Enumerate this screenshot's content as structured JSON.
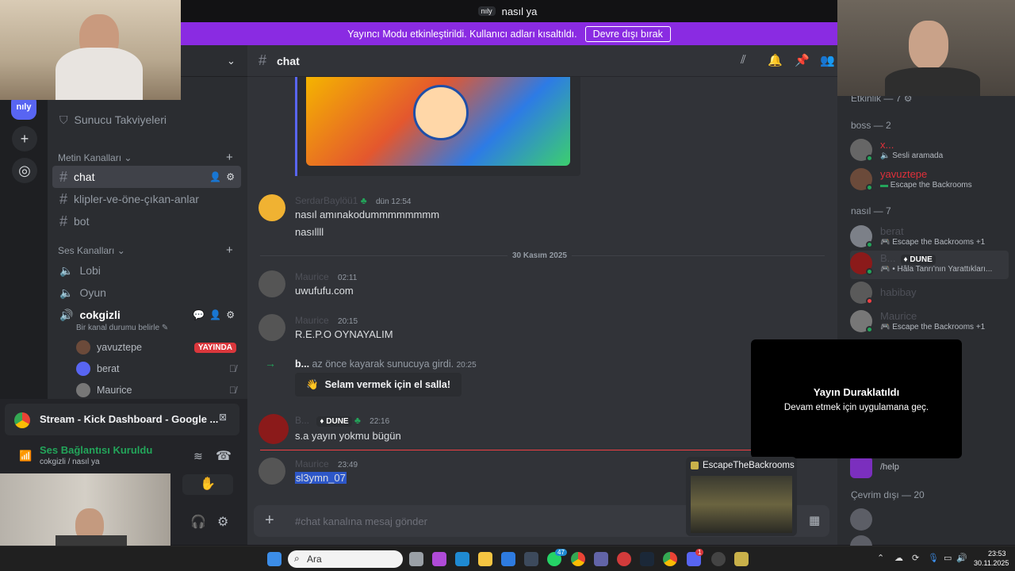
{
  "window": {
    "server_tag": "nıly",
    "title": "nasıl ya"
  },
  "banner": {
    "text": "Yayıncı Modu etkinleştirildi. Kullanıcı adları kısaltıldı.",
    "button": "Devre dışı bırak"
  },
  "server": {
    "rail_label": "nıly"
  },
  "sidebar": {
    "boost": "Sunucu Takviyeleri",
    "text_category": "Metin Kanalları",
    "text_channels": [
      {
        "name": "chat"
      },
      {
        "name": "klipler-ve-öne-çıkan-anlar"
      },
      {
        "name": "bot"
      }
    ],
    "voice_category": "Ses Kanalları",
    "voice_channels": [
      {
        "name": "Lobi"
      },
      {
        "name": "Oyun"
      },
      {
        "name": "cokgizli"
      }
    ],
    "status_hint": "Bir kanal durumu belirle",
    "voice_users": [
      {
        "name": "yavuztepe",
        "badge": "YAYINDA"
      },
      {
        "name": "berat"
      },
      {
        "name": "Maurice"
      }
    ]
  },
  "voice_panel": {
    "stream_title": "Stream - Kick Dashboard - Google ...",
    "connection": "Ses Bağlantısı Kuruldu",
    "path": "cokgizli / nasıl ya"
  },
  "chat": {
    "channel": "chat",
    "date_divider": "30 Kasım 2025",
    "messages": [
      {
        "author": "SerdarBaylöü1",
        "time": "dün 12:54",
        "lines": [
          "nasıl amınakodummmmmmmm",
          "nasıllll"
        ]
      },
      {
        "author": "Maurice",
        "time": "02:11",
        "lines": [
          "uwufufu.com"
        ]
      },
      {
        "author": "Maurice",
        "time": "20:15",
        "lines": [
          "R.E.P.O OYNAYALIM"
        ]
      },
      {
        "author": "B...",
        "badge": "DUNE",
        "time": "22:16",
        "lines": [
          "s.a yayın yokmu bügün"
        ]
      },
      {
        "author": "Maurice",
        "time": "23:49",
        "lines": [
          "sl3ymn_07"
        ]
      }
    ],
    "system_message": {
      "user": "b...",
      "text": "az önce kayarak sunucuya girdi.",
      "time": "20:25",
      "button": "Selam vermek için el salla!"
    },
    "composer_placeholder": "#chat kanalına mesaj gönder"
  },
  "members": {
    "activity_header": "Etkinlik — 7",
    "groups": [
      {
        "title": "boss — 2",
        "items": [
          {
            "name": "x...",
            "status": "Sesli aramada"
          },
          {
            "name": "yavuztepe",
            "status": "Escape the Backrooms"
          }
        ]
      },
      {
        "title": "nasıl — 7",
        "items": [
          {
            "name": "berat",
            "status": "Escape the Backrooms +1"
          },
          {
            "name": "B...",
            "badge": "DUNE",
            "status": "• Hâla Tanrı'nın Yarattıkları..."
          },
          {
            "name": "habibay",
            "status": ""
          },
          {
            "name": "Maurice",
            "status": "Escape the Backrooms +1"
          }
        ]
      },
      {
        "title": "Çevrim dışı — 20",
        "items": []
      }
    ],
    "help_item": "/help"
  },
  "overlay": {
    "paused_title": "Yayın Duraklatıldı",
    "paused_sub": "Devam etmek için uygulamana geç.",
    "thumbnail_label": "EscapeTheBackrooms"
  },
  "taskbar": {
    "search": "Ara",
    "time": "23:53",
    "date": "30.11.2025",
    "badge_whatsapp": "47",
    "badge_discord": "1"
  },
  "colors": {
    "brand": "#5865f2",
    "banner": "#8a2be2",
    "live": "#da373c",
    "online": "#23a55a"
  }
}
